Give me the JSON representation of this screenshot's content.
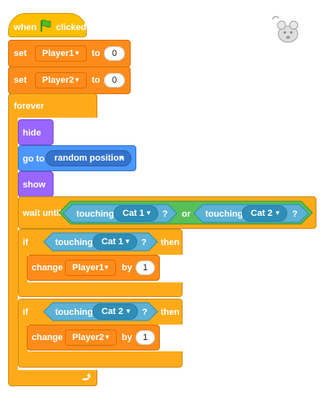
{
  "scripts": {
    "hat_when": "when",
    "hat_clicked": "clicked",
    "set_1": {
      "label": "set",
      "variable": "Player1",
      "to": "to",
      "value": "0"
    },
    "set_2": {
      "label": "set",
      "variable": "Player2",
      "to": "to",
      "value": "0"
    },
    "forever": "forever",
    "hide": "hide",
    "goto": {
      "label": "go to",
      "target": "random position"
    },
    "show": "show",
    "wait_until": {
      "label": "wait until",
      "left": {
        "label": "touching",
        "target": "Cat 1",
        "q": "?"
      },
      "op": "or",
      "right": {
        "label": "touching",
        "target": "Cat 2",
        "q": "?"
      }
    },
    "if_1": {
      "label": "if",
      "then": "then",
      "cond": {
        "label": "touching",
        "target": "Cat 1",
        "q": "?"
      },
      "body": {
        "label": "change",
        "variable": "Player1",
        "by": "by",
        "value": "1"
      }
    },
    "if_2": {
      "label": "if",
      "then": "then",
      "cond": {
        "label": "touching",
        "target": "Cat 2",
        "q": "?"
      },
      "body": {
        "label": "change",
        "variable": "Player2",
        "by": "by",
        "value": "1"
      }
    }
  },
  "sprite_icon": "mouse-icon",
  "colors": {
    "events": "#ffbf00",
    "variables": "#ff8c1a",
    "control": "#ffab19",
    "looks": "#9966ff",
    "motion": "#4c97ff",
    "sensing": "#5cb1d6",
    "operators": "#59c059"
  }
}
